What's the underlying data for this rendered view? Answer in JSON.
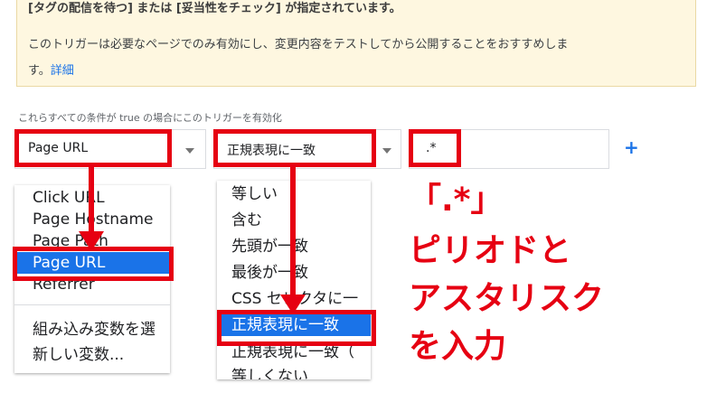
{
  "banner": {
    "line1": "[タグの配信を待つ] または [妥当性をチェック] が指定されています。",
    "line2": "このトリガーは必要なページでのみ有効にし、変更内容をテストしてから公開することをおすすめしま",
    "line3_text": "す。",
    "line3_link": "詳細"
  },
  "conditions": {
    "label": "これらすべての条件が true の場合にこのトリガーを有効化",
    "variable": "Page URL",
    "operator": "正規表現に一致",
    "value": ".*",
    "add_label": "+"
  },
  "variable_menu": {
    "items": [
      "Click URL",
      "Page Hostname",
      "Page Path",
      "Page URL",
      "Referrer"
    ],
    "selected": "Page URL",
    "extra_items": [
      "組み込み変数を選",
      "新しい変数..."
    ]
  },
  "operator_menu": {
    "items": [
      "等しい",
      "含む",
      "先頭が一致",
      "最後が一致",
      "CSS セレクタに一",
      "正規表現に一致",
      "正規表現に一致（",
      "等しくない"
    ],
    "selected": "正規表現に一致"
  },
  "annotation": {
    "line1": "「.*」",
    "line2": "ピリオドと",
    "line3": "アスタリスク",
    "line4": "を入力"
  },
  "colors": {
    "highlight": "#e60012",
    "accent": "#1a73e8",
    "banner_bg": "#fef7e0"
  }
}
